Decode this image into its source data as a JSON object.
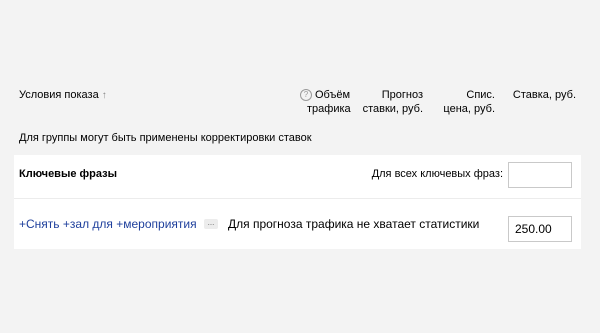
{
  "header": {
    "conditions": "Условия показа",
    "conditions_sort_icon": "arrow-up",
    "traffic_line1": "Объём",
    "traffic_line2": "трафика",
    "traffic_help_icon": "question-circle",
    "forecast_line1": "Прогноз",
    "forecast_line2": "ставки, руб.",
    "price_line1": "Спис.",
    "price_line2": "цена, руб.",
    "bid": "Ставка, руб."
  },
  "notice": "Для группы могут быть применены корректировки ставок",
  "keywords": {
    "title": "Ключевые фразы",
    "all_label": "Для всех ключевых фраз:",
    "all_value": ""
  },
  "row": {
    "phrase": "+Снять +зал для +мероприятия",
    "more": "...",
    "status": "Для прогноза трафика не хватает статистики",
    "bid_value": "250.00"
  },
  "colors": {
    "background": "#f3f3f3",
    "panel": "#ffffff",
    "link": "#1e3f9c"
  }
}
